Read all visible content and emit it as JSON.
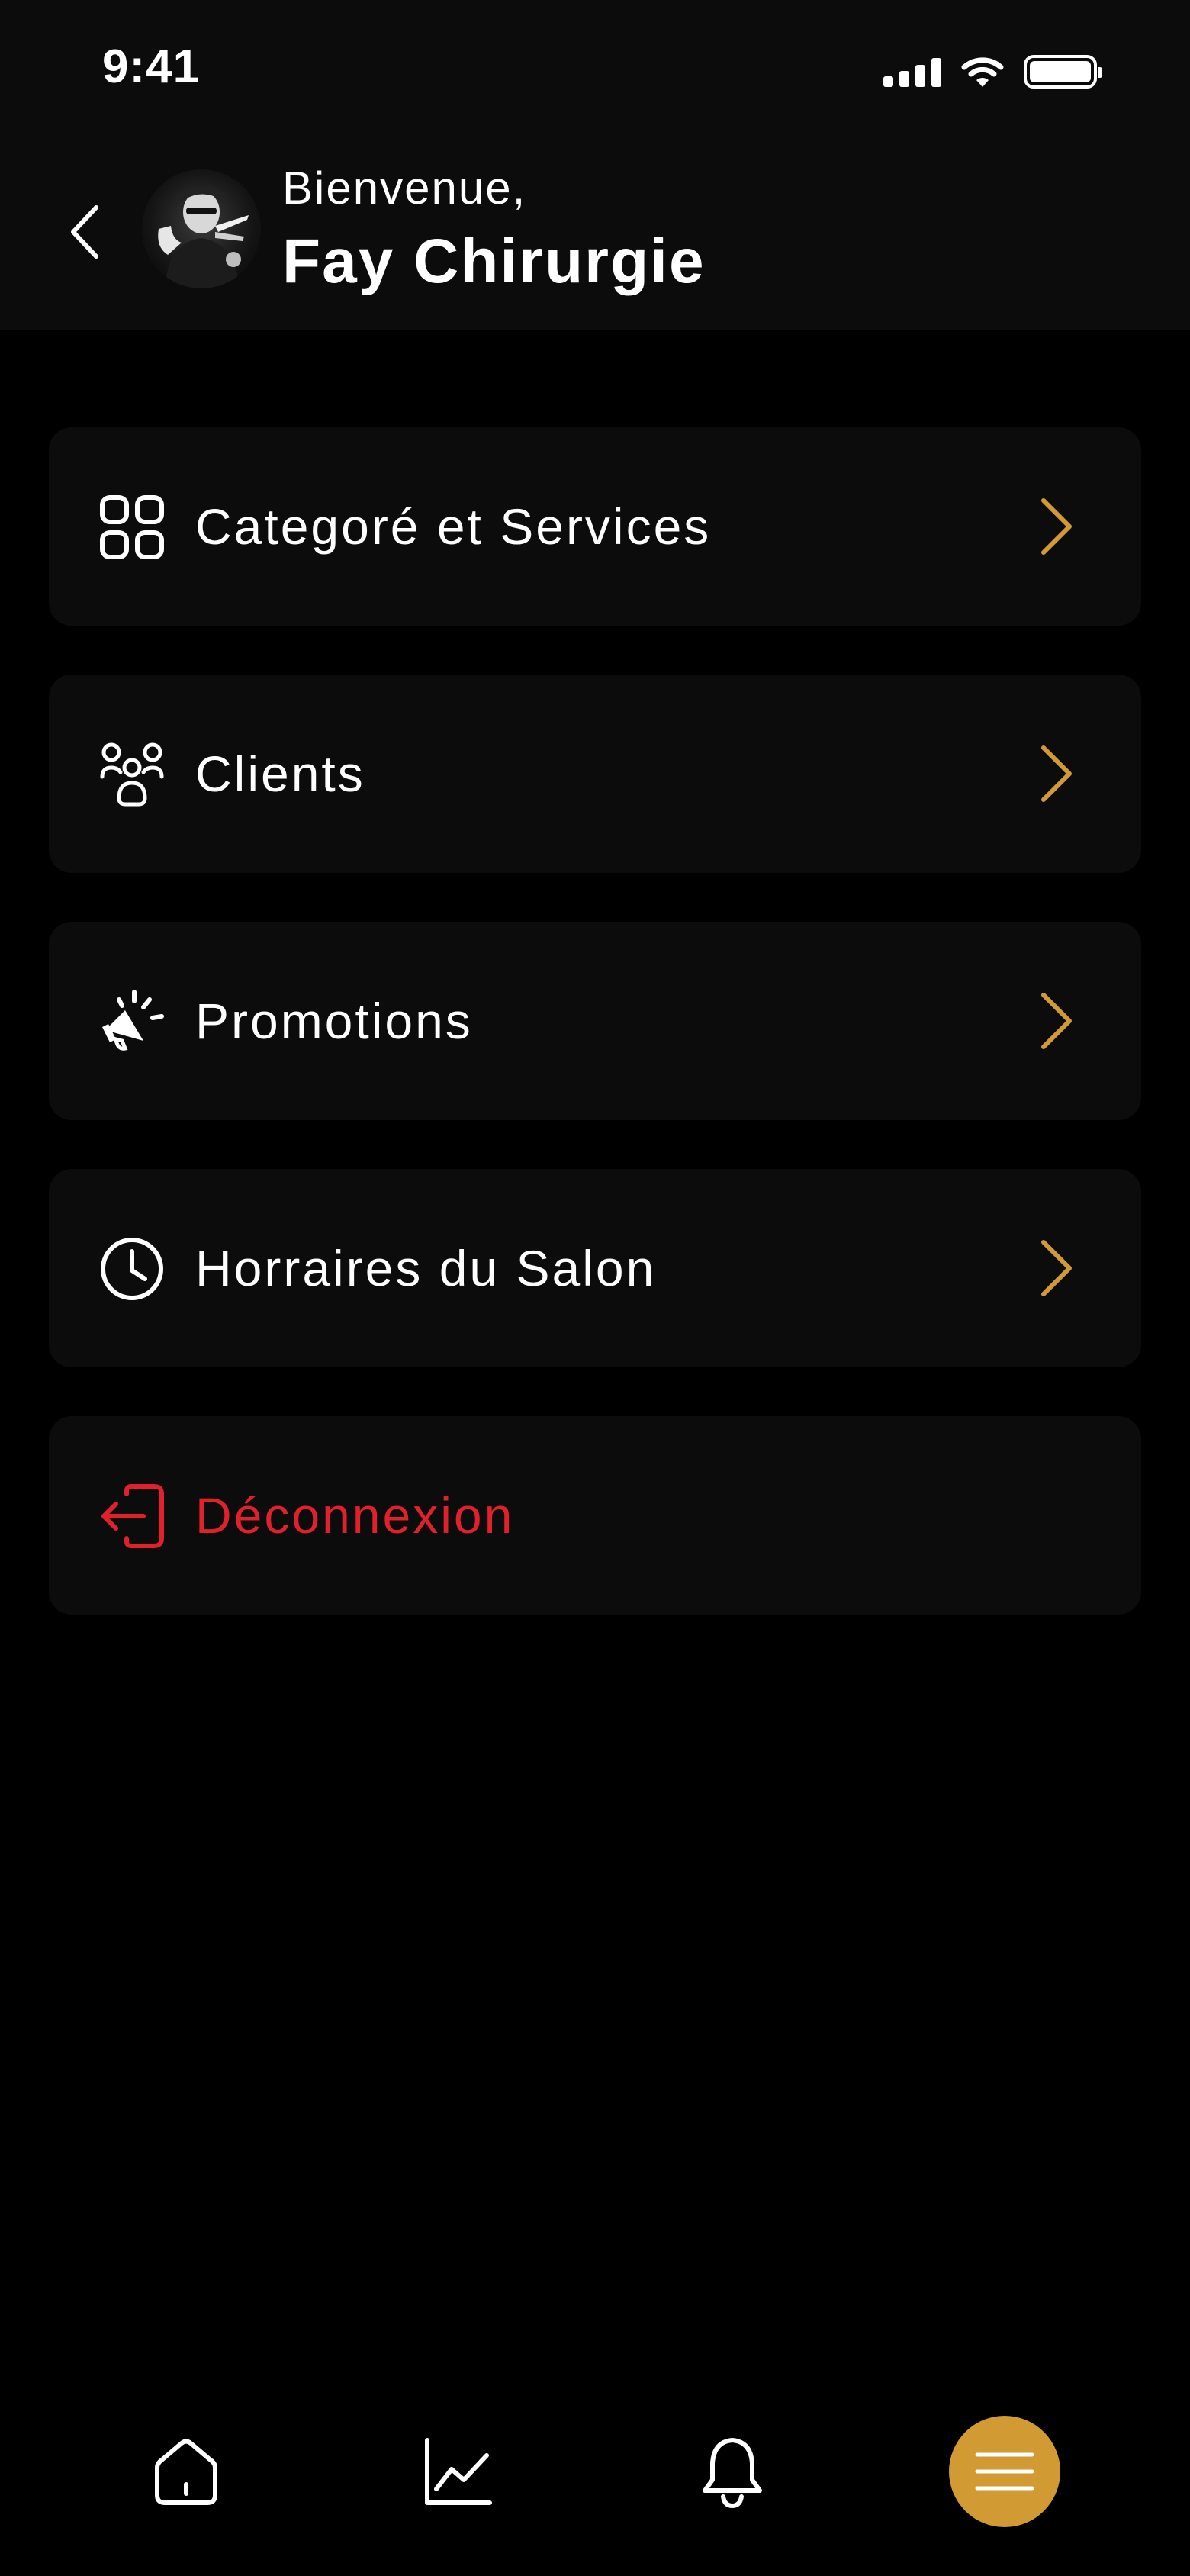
{
  "status_bar": {
    "time": "9:41"
  },
  "header": {
    "greeting": "Bienvenue,",
    "username": "Fay Chirurgie"
  },
  "menu": {
    "items": [
      {
        "label": "Categoré et Services",
        "icon": "grid-icon"
      },
      {
        "label": "Clients",
        "icon": "users-group-icon"
      },
      {
        "label": "Promotions",
        "icon": "megaphone-icon"
      },
      {
        "label": "Horraires du Salon",
        "icon": "clock-icon"
      }
    ],
    "logout_label": "Déconnexion"
  },
  "bottom_nav": {
    "items": [
      "home-icon",
      "chart-icon",
      "bell-icon",
      "menu-icon"
    ],
    "active": "menu-icon"
  },
  "colors": {
    "accent": "#d29a33",
    "danger": "#e0202a",
    "background": "#000000",
    "card": "#0c0c0c"
  }
}
